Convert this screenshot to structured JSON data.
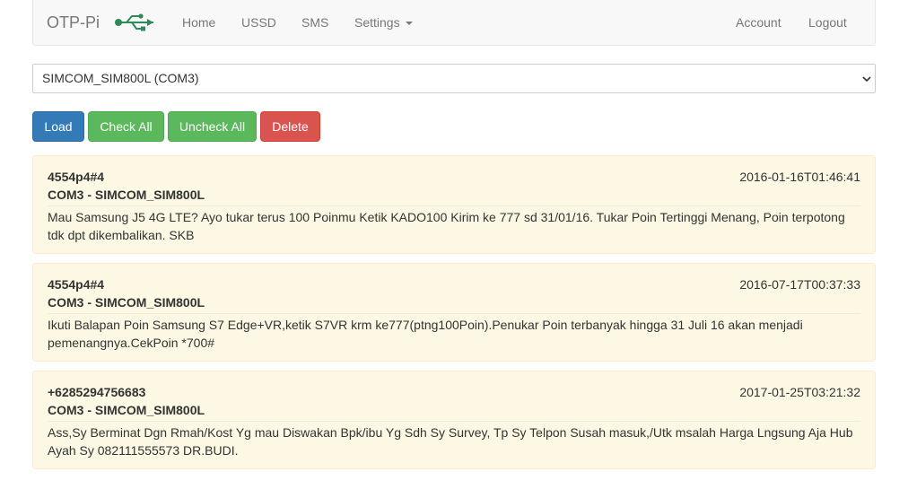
{
  "navbar": {
    "brand": "OTP-Pi",
    "brand_icon": "usb-icon",
    "items": [
      {
        "label": "Home"
      },
      {
        "label": "USSD"
      },
      {
        "label": "SMS"
      },
      {
        "label": "Settings"
      }
    ],
    "right_items": [
      {
        "label": "Account"
      },
      {
        "label": "Logout"
      }
    ]
  },
  "device_select": {
    "value": "SIMCOM_SIM800L (COM3)"
  },
  "toolbar": {
    "load_label": "Load",
    "check_all_label": "Check All",
    "uncheck_all_label": "Uncheck All",
    "delete_label": "Delete"
  },
  "colors": {
    "primary": "#337ab7",
    "success": "#5cb85c",
    "danger": "#d9534f",
    "message_bg": "#fcf8e3"
  },
  "messages": [
    {
      "sender": "4554p4#4",
      "timestamp": "2016-01-16T01:46:41",
      "device": "COM3 - SIMCOM_SIM800L",
      "body": "Mau Samsung J5 4G LTE? Ayo tukar terus 100 Poinmu Ketik KADO100 Kirim ke 777 sd 31/01/16. Tukar Poin Tertinggi Menang, Poin terpotong tdk dpt dikembalikan. SKB"
    },
    {
      "sender": "4554p4#4",
      "timestamp": "2016-07-17T00:37:33",
      "device": "COM3 - SIMCOM_SIM800L",
      "body": "Ikuti Balapan Poin Samsung S7 Edge+VR,ketik S7VR krm ke777(ptng100Poin).Penukar Poin terbanyak hingga 31 Juli 16 akan menjadi pemenangnya.CekPoin *700#"
    },
    {
      "sender": "+6285294756683",
      "timestamp": "2017-01-25T03:21:32",
      "device": "COM3 - SIMCOM_SIM800L",
      "body": "Ass,Sy Berminat Dgn Rmah/Kost Yg mau Diswakan Bpk/ibu Yg Sdh Sy Survey, Tp Sy Telpon Susah masuk,/Utk msalah Harga Lngsung Aja Hub Ayah Sy 082111555573 DR.BUDI."
    }
  ]
}
